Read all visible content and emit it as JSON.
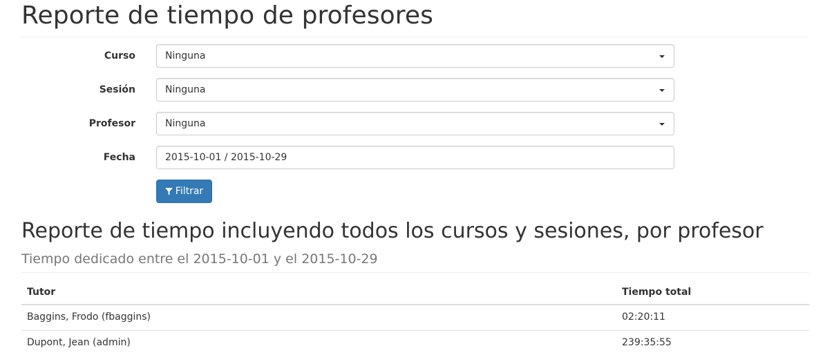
{
  "page": {
    "title": "Reporte de tiempo de profesores"
  },
  "filters": {
    "course": {
      "label": "Curso",
      "value": "Ninguna"
    },
    "session": {
      "label": "Sesión",
      "value": "Ninguna"
    },
    "teacher": {
      "label": "Profesor",
      "value": "Ninguna"
    },
    "date": {
      "label": "Fecha",
      "value": "2015-10-01 / 2015-10-29"
    },
    "submit_label": "Filtrar",
    "submit_icon": "filter-icon"
  },
  "report": {
    "title": "Reporte de tiempo incluyendo todos los cursos y sesiones, por profesor",
    "subtitle": "Tiempo dedicado entre el 2015-10-01 y el 2015-10-29",
    "columns": [
      "Tutor",
      "Tiempo total"
    ],
    "rows": [
      [
        "Baggins, Frodo (fbaggins)",
        "02:20:11"
      ],
      [
        "Dupont, Jean (admin)",
        "239:35:55"
      ]
    ]
  },
  "colors": {
    "primary": "#337ab7",
    "muted": "#777777",
    "border": "#dddddd"
  }
}
